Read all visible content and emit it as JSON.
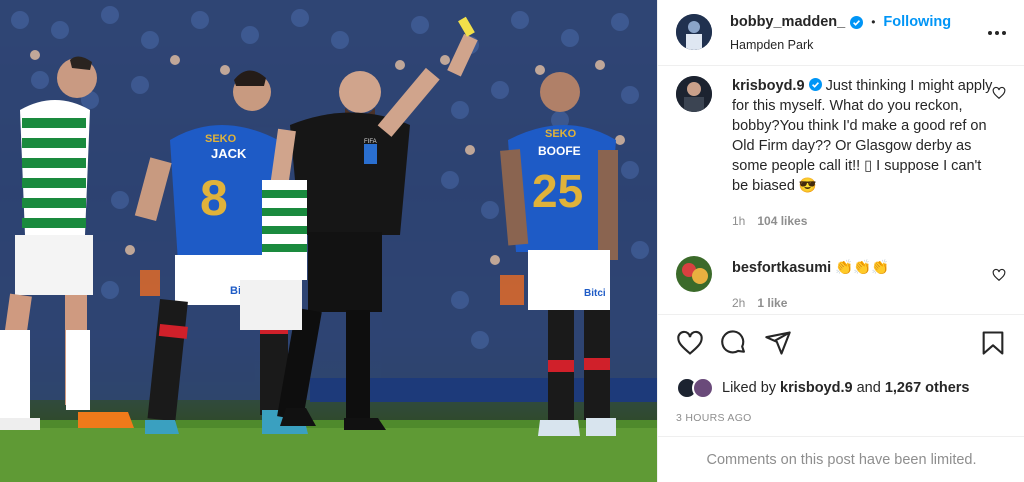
{
  "post": {
    "author": "bobby_madden_",
    "separator": "•",
    "follow_label": "Following",
    "location": "Hampden Park",
    "more_icon": "more-horizontal-icon",
    "photo_text": {
      "ref_badge": "FIFA",
      "sponsor": "SEKO",
      "player_left_name": "JACK",
      "player_left_number": "8",
      "player_right_name": "BOOFE",
      "player_right_number": "25",
      "shorts_sponsor": "Bitci"
    }
  },
  "comments": [
    {
      "username": "krisboyd.9",
      "verified": true,
      "text": "Just thinking I might apply for this myself. What do you reckon, bobby?You think I'd make a good ref on Old Firm day?? Or Glasgow derby as some people call it!! ▯ I suppose I can't be biased 😎",
      "time": "1h",
      "likes": "104 likes"
    },
    {
      "username": "besfortkasumi",
      "verified": false,
      "text": "👏👏👏",
      "time": "2h",
      "likes": "1 like"
    }
  ],
  "actions": {
    "liked_by_prefix": "Liked by",
    "liked_by_user": "krisboyd.9",
    "liked_by_and": "and",
    "liked_by_others": "1,267 others",
    "timestamp": "3 HOURS AGO"
  },
  "footer": {
    "limited_text": "Comments on this post have been limited."
  },
  "colors": {
    "accent": "#0095f6",
    "rangers_blue": "#1e5bc6",
    "celtic_green": "#1a8a3e",
    "gold_number": "#e0b23a"
  }
}
